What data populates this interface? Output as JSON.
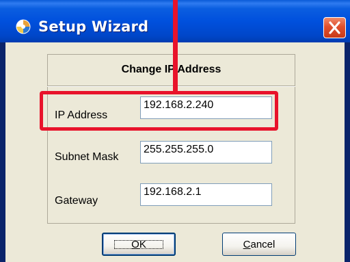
{
  "window": {
    "title": "Setup Wizard"
  },
  "dialog": {
    "section_title": "Change IP Address",
    "fields": [
      {
        "label": "IP Address",
        "value": "192.168.2.240"
      },
      {
        "label": "Subnet Mask",
        "value": "255.255.255.0"
      },
      {
        "label": "Gateway",
        "value": "192.168.2.1"
      }
    ]
  },
  "buttons": {
    "ok": {
      "mnemonic": "O",
      "rest": "K"
    },
    "cancel": {
      "mnemonic": "C",
      "rest": "ancel"
    }
  },
  "colors": {
    "titlebar": "#0050dd",
    "client": "#ece9d8",
    "highlight": "#e8132b",
    "close_button": "#e0502e"
  },
  "icons": [
    "app-icon",
    "close-icon"
  ]
}
